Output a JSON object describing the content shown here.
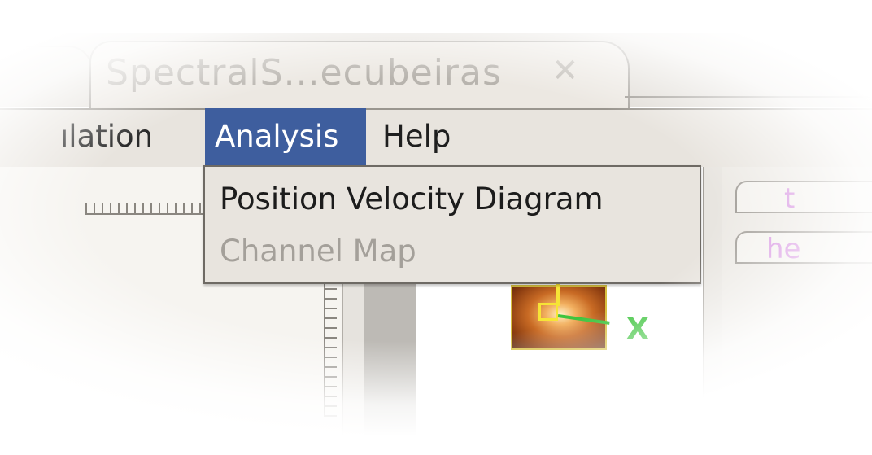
{
  "window": {
    "tab_title": "SpectralS...ecubeiras",
    "tab_close_glyph": "✕"
  },
  "menubar": {
    "items": [
      {
        "label": "ılation",
        "id": "manipulation"
      },
      {
        "label": "Analysis",
        "id": "analysis",
        "active": true
      },
      {
        "label": "Help",
        "id": "help"
      }
    ]
  },
  "analysis_menu": {
    "items": [
      {
        "label": "Position Velocity Diagram",
        "enabled": true
      },
      {
        "label": "Channel Map",
        "enabled": false
      }
    ]
  },
  "right_panel": {
    "tabs": [
      {
        "label": "t"
      },
      {
        "label": "he"
      }
    ]
  },
  "canvas": {
    "marker_label": "X"
  },
  "colors": {
    "menu_highlight": "#3e5e9e",
    "disabled_text": "#a4a09a",
    "marker_green": "#3ec43e",
    "marker_yellow": "#f6e436",
    "tab_text": "#d58ee0"
  }
}
